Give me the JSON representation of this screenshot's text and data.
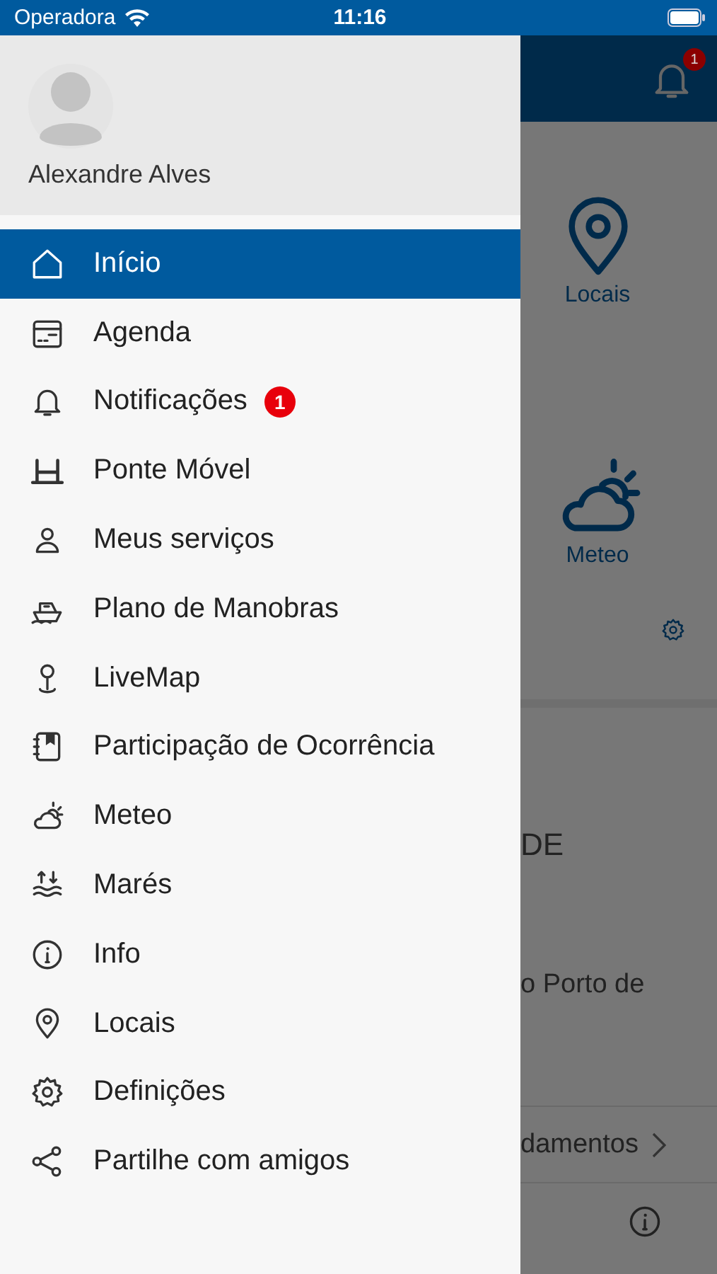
{
  "status_bar": {
    "carrier": "Operadora",
    "time": "11:16"
  },
  "background": {
    "notification_badge": "1",
    "tiles": [
      {
        "label": "Locais"
      },
      {
        "label": "Meteo"
      }
    ],
    "heading": "DE",
    "text": "o Porto de",
    "link": "damentos"
  },
  "drawer": {
    "user_name": "Alexandre Alves",
    "items": [
      {
        "label": "Início",
        "selected": true
      },
      {
        "label": "Agenda",
        "selected": false
      },
      {
        "label": "Notificações",
        "selected": false,
        "badge": "1"
      },
      {
        "label": "Ponte Móvel",
        "selected": false
      },
      {
        "label": "Meus serviços",
        "selected": false
      },
      {
        "label": "Plano de Manobras",
        "selected": false
      },
      {
        "label": "LiveMap",
        "selected": false
      },
      {
        "label": "Participação de Ocorrência",
        "selected": false
      },
      {
        "label": "Meteo",
        "selected": false
      },
      {
        "label": "Marés",
        "selected": false
      },
      {
        "label": "Info",
        "selected": false
      },
      {
        "label": "Locais",
        "selected": false
      },
      {
        "label": "Definições",
        "selected": false
      },
      {
        "label": "Partilhe com amigos",
        "selected": false
      }
    ]
  }
}
